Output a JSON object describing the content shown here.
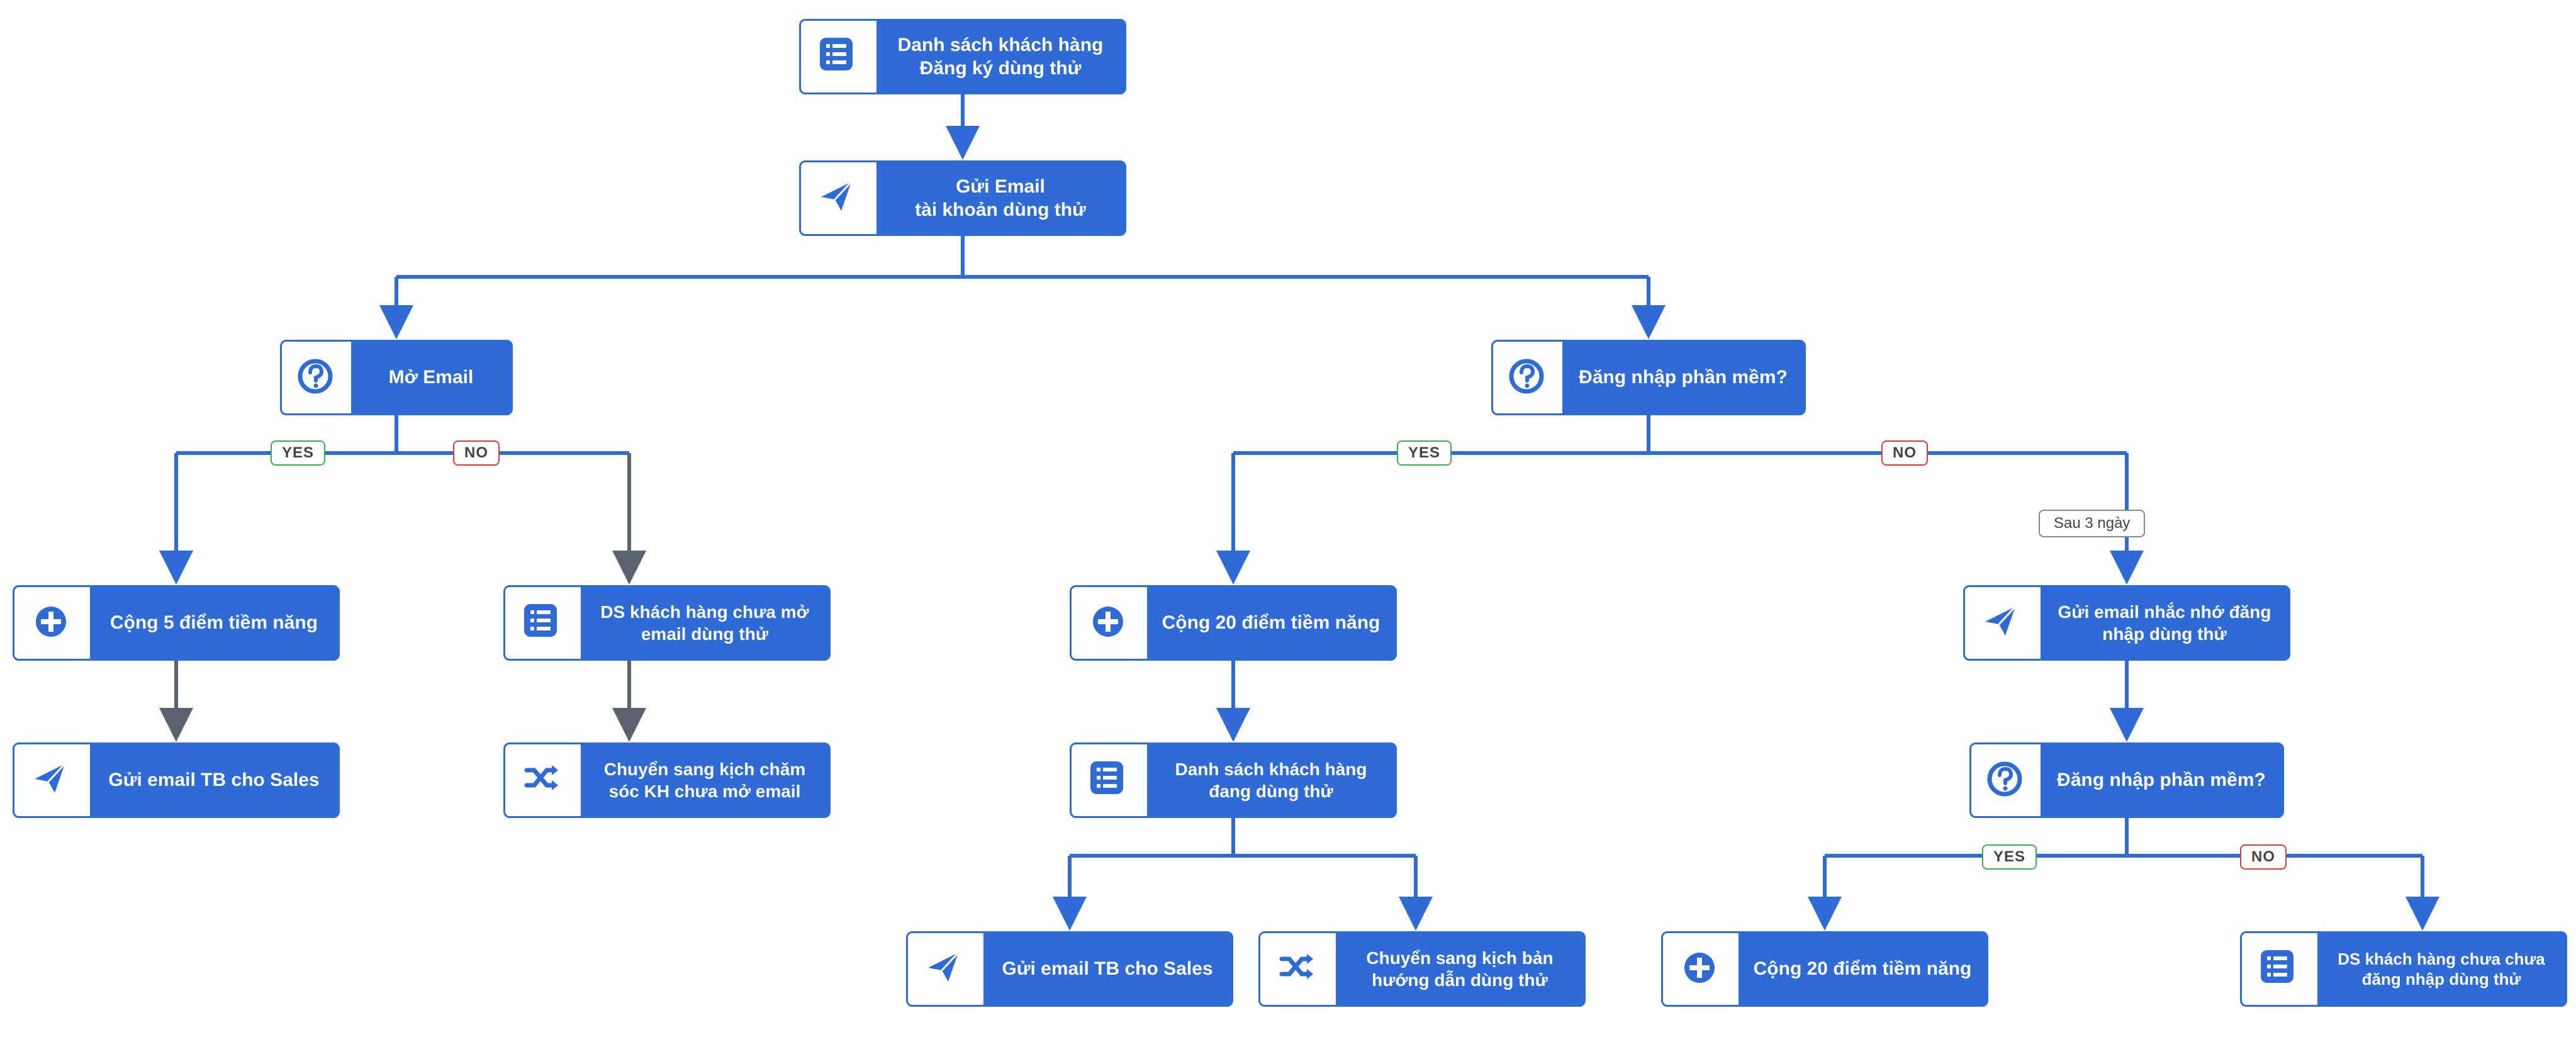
{
  "colors": {
    "primary": "#2f6bd6",
    "yes_border": "#38b24a",
    "no_border": "#e03a3a",
    "neutral_border": "#888888",
    "arrow_grey": "#5b6270"
  },
  "badges": {
    "yes": "YES",
    "no": "NO",
    "after3days": "Sau 3 ngày"
  },
  "nodes": {
    "n1": {
      "icon": "list",
      "label": "Danh sách khách hàng\nĐăng ký dùng thử"
    },
    "n2": {
      "icon": "send",
      "label": "Gửi Email\ntài khoản dùng thử"
    },
    "n3": {
      "icon": "question",
      "label": "Mở Email"
    },
    "n4": {
      "icon": "question",
      "label": "Đăng nhập phần mềm?"
    },
    "n5": {
      "icon": "plus",
      "label": "Cộng 5 điểm tiềm năng"
    },
    "n6": {
      "icon": "list",
      "label": "DS khách hàng chưa mở\nemail dùng thử"
    },
    "n7": {
      "icon": "plus",
      "label": "Cộng 20 điểm tiềm năng"
    },
    "n8": {
      "icon": "send",
      "label": "Gửi email nhắc nhớ đăng\nnhập dùng thử"
    },
    "n9": {
      "icon": "send",
      "label": "Gửi email TB cho Sales"
    },
    "n10": {
      "icon": "shuffle",
      "label": "Chuyển sang kịch chăm\nsóc KH chưa mở email"
    },
    "n11": {
      "icon": "list",
      "label": "Danh sách khách hàng\nđang dùng thử"
    },
    "n12": {
      "icon": "question",
      "label": "Đăng nhập phần mềm?"
    },
    "n13": {
      "icon": "send",
      "label": "Gửi email TB cho Sales"
    },
    "n14": {
      "icon": "shuffle",
      "label": "Chuyển sang kịch bản\nhướng dẫn dùng thử"
    },
    "n15": {
      "icon": "plus",
      "label": "Cộng 20 điểm tiềm năng"
    },
    "n16": {
      "icon": "list",
      "label": "DS khách hàng chưa chưa\nđăng nhập dùng thử"
    }
  }
}
